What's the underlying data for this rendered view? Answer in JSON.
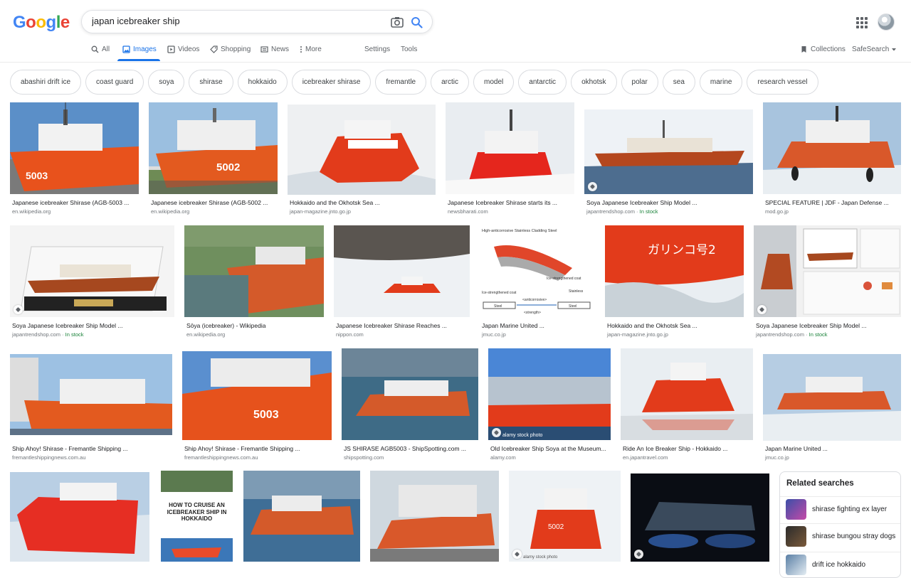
{
  "logo": [
    "G",
    "o",
    "o",
    "g",
    "l",
    "e"
  ],
  "logo_colors": [
    "#4285F4",
    "#EA4335",
    "#FBBC05",
    "#4285F4",
    "#34A853",
    "#EA4335"
  ],
  "search": {
    "query": "japan icebreaker ship",
    "camera_icon": "camera-icon",
    "search_icon": "search-icon"
  },
  "header": {
    "apps_icon": "apps-grid-icon",
    "avatar": "account-avatar"
  },
  "nav": {
    "all": "All",
    "images": "Images",
    "videos": "Videos",
    "shopping": "Shopping",
    "news": "News",
    "more": "More",
    "settings": "Settings",
    "tools": "Tools",
    "collections": "Collections",
    "safesearch": "SafeSearch"
  },
  "chips": [
    "abashiri drift ice",
    "coast guard",
    "soya",
    "shirase",
    "hokkaido",
    "icebreaker shirase",
    "fremantle",
    "arctic",
    "model",
    "antarctic",
    "okhotsk",
    "polar",
    "sea",
    "marine",
    "research vessel"
  ],
  "results": [
    {
      "caption": "Japanese icebreaker Shirase (AGB-5003 ...",
      "source": "en.wikipedia.org",
      "stock": ""
    },
    {
      "caption": "Japanese icebreaker Shirase (AGB-5002 ...",
      "source": "en.wikipedia.org",
      "stock": ""
    },
    {
      "caption": "Hokkaido and the Okhotsk Sea ...",
      "source": "japan-magazine.jnto.go.jp",
      "stock": ""
    },
    {
      "caption": "Japanese Icebreaker Shirase starts its ...",
      "source": "newsbharati.com",
      "stock": ""
    },
    {
      "caption": "Soya Japanese Icebreaker Ship Model ...",
      "source": "japantrendshop.com · ",
      "stock": "In stock"
    },
    {
      "caption": "SPECIAL FEATURE | JDF - Japan Defense ...",
      "source": "mod.go.jp",
      "stock": ""
    },
    {
      "caption": "Soya Japanese Icebreaker Ship Model ...",
      "source": "japantrendshop.com · ",
      "stock": "In stock"
    },
    {
      "caption": "Sōya (icebreaker) - Wikipedia",
      "source": "en.wikipedia.org",
      "stock": ""
    },
    {
      "caption": "Japanese Icebreaker Shirase Reaches ...",
      "source": "nippon.com",
      "stock": ""
    },
    {
      "caption": "Japan Marine United ...",
      "source": "jmuc.co.jp",
      "stock": ""
    },
    {
      "caption": "Hokkaido and the Okhotsk Sea ...",
      "source": "japan-magazine.jnto.go.jp",
      "stock": ""
    },
    {
      "caption": "Soya Japanese Icebreaker Ship Model ...",
      "source": "japantrendshop.com · ",
      "stock": "In stock"
    },
    {
      "caption": "Ship Ahoy! Shirase - Fremantle Shipping ...",
      "source": "fremantleshippingnews.com.au",
      "stock": ""
    },
    {
      "caption": "Ship Ahoy! Shirase - Fremantle Shipping ...",
      "source": "fremantleshippingnews.com.au",
      "stock": ""
    },
    {
      "caption": "JS SHIRASE AGB5003 - ShipSpotting.com ...",
      "source": "shipspotting.com",
      "stock": ""
    },
    {
      "caption": "Old Icebreaker Ship Soya at the Museum...",
      "source": "alamy.com",
      "stock": ""
    },
    {
      "caption": "Ride An Ice Breaker Ship - Hokkaido ...",
      "source": "en.japantravel.com",
      "stock": ""
    },
    {
      "caption": "Japan Marine United ...",
      "source": "jmuc.co.jp",
      "stock": ""
    }
  ],
  "image_texts": {
    "hull_5003": "5003",
    "hull_5002": "5002",
    "garinko": "ガリンコ号2",
    "cruise_poster": "HOW TO CRUISE AN ICEBREAKER SHIP IN HOKKAIDO",
    "alamy": "alamy stock photo",
    "diagram_top": "High-anticorrosive Stainless Cladding Steel",
    "diagram_coat": "Ice-strengthened coat",
    "diagram_left": "Ice-strengthened coat",
    "diagram_stainless": "Stainless",
    "diagram_anti": "<anticorrosive>",
    "diagram_steel": "Steel",
    "diagram_strength": "<strength>"
  },
  "related": {
    "title": "Related searches",
    "items": [
      "shirase fighting ex layer",
      "shirase bungou stray dogs",
      "drift ice hokkaido"
    ]
  },
  "colors": {
    "accent": "#1a73e8",
    "hull_orange": "#e8521c",
    "in_stock": "#188038"
  }
}
